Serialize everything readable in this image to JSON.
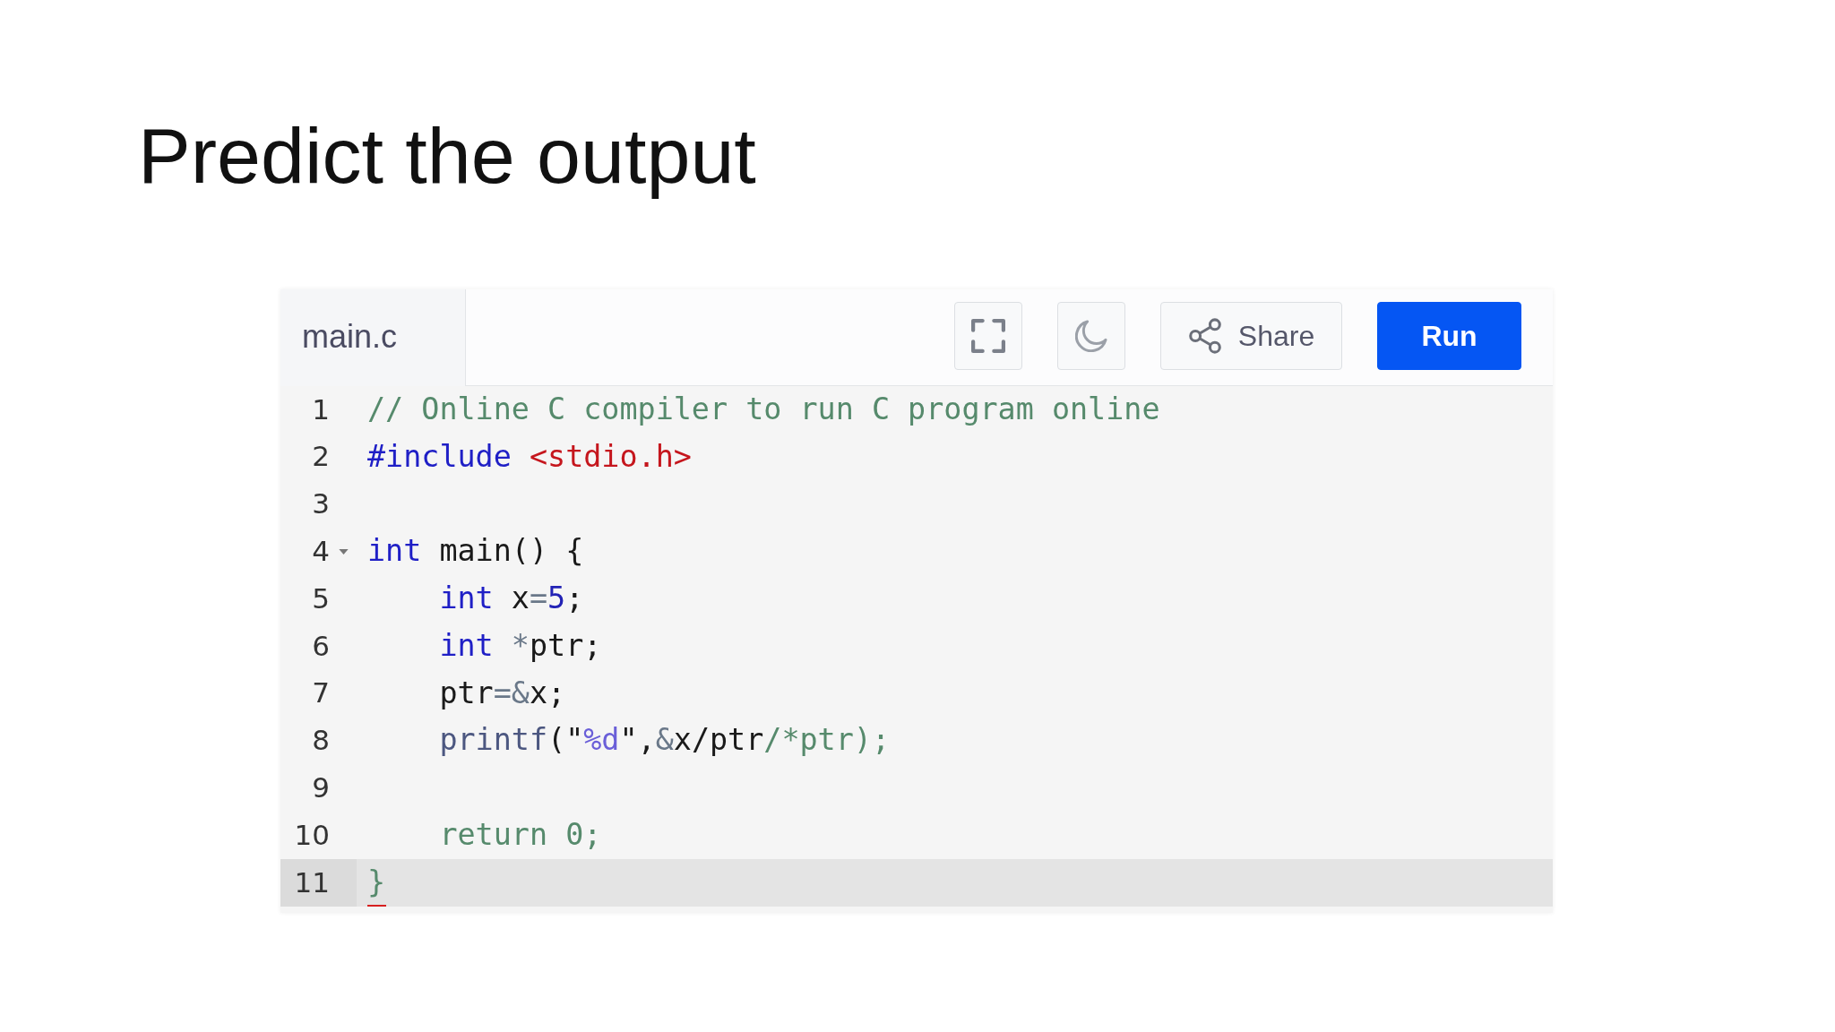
{
  "slide": {
    "title": "Predict the output"
  },
  "editor": {
    "tabs": [
      {
        "label": "main.c",
        "selected": true
      }
    ],
    "toolbar": [
      {
        "kind": "fullscreen"
      },
      {
        "kind": "theme"
      },
      {
        "kind": "share",
        "label": "Share"
      },
      {
        "kind": "run",
        "label": "Run"
      }
    ],
    "lines": [
      {
        "number": "1",
        "active": false,
        "foldable": false,
        "error": false,
        "tokens": [
          {
            "kind": "comment",
            "text": "// Online C compiler to run C program online"
          }
        ]
      },
      {
        "number": "2",
        "active": false,
        "foldable": false,
        "error": false,
        "tokens": [
          {
            "kind": "keyword",
            "text": "#include"
          },
          {
            "kind": "header",
            "text": " <stdio.h>"
          }
        ]
      },
      {
        "number": "3",
        "active": false,
        "foldable": false,
        "error": false
      },
      {
        "number": "4",
        "active": false,
        "foldable": true,
        "error": false,
        "tokens": [
          {
            "kind": "keyword",
            "text": "int"
          },
          {
            "kind": "plain",
            "text": " main() {"
          }
        ]
      },
      {
        "number": "5",
        "active": false,
        "foldable": false,
        "error": false,
        "tokens": [
          {
            "kind": "keyword",
            "text": "    int"
          },
          {
            "kind": "plain",
            "text": " x"
          },
          {
            "kind": "operator",
            "text": "="
          },
          {
            "kind": "number",
            "text": "5"
          },
          {
            "kind": "plain",
            "text": ";"
          }
        ]
      },
      {
        "number": "6",
        "active": false,
        "foldable": false,
        "error": false,
        "tokens": [
          {
            "kind": "keyword",
            "text": "    int"
          },
          {
            "kind": "operator",
            "text": " *"
          },
          {
            "kind": "plain",
            "text": "ptr;"
          }
        ]
      },
      {
        "number": "7",
        "active": false,
        "foldable": false,
        "error": false,
        "tokens": [
          {
            "kind": "plain",
            "text": "    ptr"
          },
          {
            "kind": "operator",
            "text": "=&"
          },
          {
            "kind": "plain",
            "text": "x;"
          }
        ]
      },
      {
        "number": "8",
        "active": false,
        "foldable": false,
        "error": false,
        "tokens": [
          {
            "kind": "function",
            "text": "    printf"
          },
          {
            "kind": "plain",
            "text": "(\""
          },
          {
            "kind": "format",
            "text": "%d"
          },
          {
            "kind": "plain",
            "text": "\","
          },
          {
            "kind": "operator",
            "text": "&"
          },
          {
            "kind": "plain",
            "text": "x/ptr"
          },
          {
            "kind": "comment",
            "text": "/*ptr);"
          }
        ]
      },
      {
        "number": "9",
        "active": false,
        "foldable": false,
        "error": false
      },
      {
        "number": "10",
        "active": false,
        "foldable": false,
        "error": false,
        "tokens": [
          {
            "kind": "comment",
            "text": "    return 0;"
          }
        ]
      },
      {
        "number": "11",
        "active": true,
        "foldable": false,
        "error": true,
        "tokens": [
          {
            "kind": "comment",
            "text": "}"
          }
        ]
      }
    ]
  }
}
